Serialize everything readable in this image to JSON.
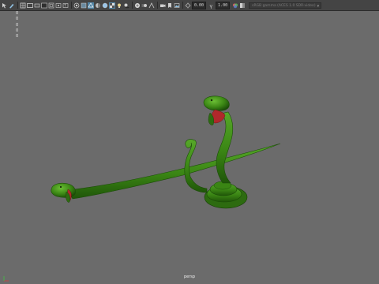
{
  "toolbar": {
    "tools": [
      {
        "name": "select-icon",
        "active": false
      },
      {
        "name": "paint-select-icon",
        "active": false
      },
      {
        "name": "sep"
      },
      {
        "name": "grid-icon",
        "active": false
      },
      {
        "name": "film-gate-icon",
        "active": false
      },
      {
        "name": "resolution-gate-icon",
        "active": false
      },
      {
        "name": "gate-mask-icon",
        "active": false
      },
      {
        "name": "field-chart-icon",
        "active": false
      },
      {
        "name": "safe-action-icon",
        "active": false
      },
      {
        "name": "safe-title-icon",
        "active": false
      },
      {
        "name": "sep"
      },
      {
        "name": "isolate-icon",
        "active": false
      },
      {
        "name": "xray-icon",
        "active": false
      },
      {
        "name": "wireframe-icon",
        "active": true
      },
      {
        "name": "smooth-shade-icon",
        "active": false
      },
      {
        "name": "default-material-icon",
        "active": false
      },
      {
        "name": "textured-icon",
        "active": true
      },
      {
        "name": "lights-icon",
        "active": false
      },
      {
        "name": "shadows-icon",
        "active": false
      },
      {
        "name": "sep"
      },
      {
        "name": "ambient-occlusion-icon",
        "active": false
      },
      {
        "name": "motion-blur-icon",
        "active": false
      },
      {
        "name": "antialias-icon",
        "active": false
      },
      {
        "name": "sep"
      },
      {
        "name": "camera-attributes-icon",
        "active": false
      },
      {
        "name": "bookmark-icon",
        "active": false
      },
      {
        "name": "image-plane-icon",
        "active": false
      },
      {
        "name": "sep"
      },
      {
        "name": "exposure-icon",
        "active": false
      }
    ],
    "exposure_value": "0.00",
    "gamma_icon": "gamma-icon",
    "gamma_value": "1.00",
    "extra_icons": [
      "color-management-icon",
      "view-transform-icon"
    ],
    "camera_select": "sRGB gamma (ACES 1.0 SDR-video)"
  },
  "hud": {
    "values": [
      "0",
      "0",
      "0",
      "0",
      "0"
    ]
  },
  "viewport": {
    "background": "#6b6b6b",
    "camera_label": "persp",
    "snake_color": "#3f8f1a",
    "snake_dark": "#245c0c",
    "mouth_color": "#b0282b"
  }
}
